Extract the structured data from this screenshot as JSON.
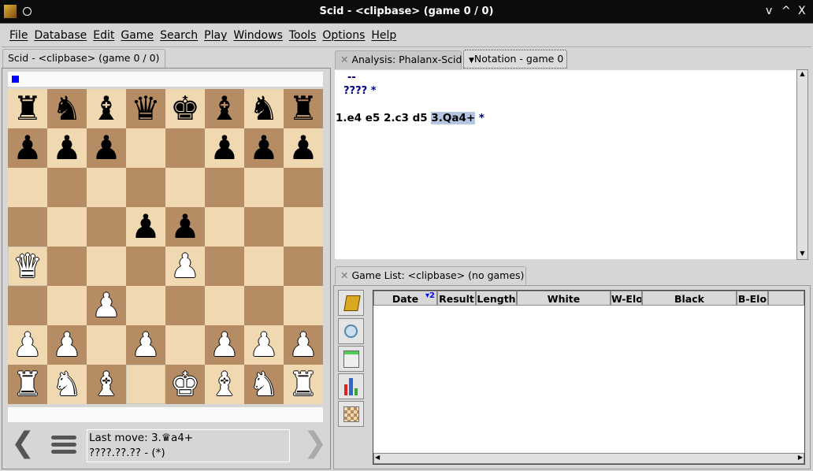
{
  "window": {
    "title": "Scid - <clipbase> (game 0 / 0)",
    "controls": [
      "v",
      "^",
      "X"
    ]
  },
  "menu": [
    "File",
    "Database",
    "Edit",
    "Game",
    "Search",
    "Play",
    "Windows",
    "Tools",
    "Options",
    "Help"
  ],
  "board_tab": "Scid - <clipbase> (game 0 / 0)",
  "board": [
    [
      "bR",
      "bN",
      "bB",
      "bQ",
      "bK",
      "bB",
      "bN",
      "bR"
    ],
    [
      "bP",
      "bP",
      "bP",
      "",
      "",
      "bP",
      "bP",
      "bP"
    ],
    [
      "",
      "",
      "",
      "",
      "",
      "",
      "",
      ""
    ],
    [
      "",
      "",
      "",
      "bP",
      "bP",
      "",
      "",
      ""
    ],
    [
      "wQ",
      "",
      "",
      "",
      "wP",
      "",
      "",
      ""
    ],
    [
      "",
      "",
      "wP",
      "",
      "",
      "",
      "",
      ""
    ],
    [
      "wP",
      "wP",
      "",
      "wP",
      "",
      "wP",
      "wP",
      "wP"
    ],
    [
      "wR",
      "wN",
      "wB",
      "",
      "wK",
      "wB",
      "wN",
      "wR"
    ]
  ],
  "highlight_squares": [
    "a4",
    "d1"
  ],
  "side_to_move_color": "#0000ff",
  "status": {
    "last_move": "Last move: 3.♛a4+",
    "game_info": "????.??.?? -  (*)"
  },
  "right_tabs": {
    "analysis": "Analysis: Phalanx-Scid",
    "notation": "Notation - game 0"
  },
  "notation": {
    "line1": "--",
    "line2": "????  *",
    "moves": "1.e4 e5 2.c3 d5 ",
    "current_move": "3.Qa4+",
    "result": " *"
  },
  "gamelist": {
    "tab": "Game List: <clipbase> (no games)",
    "sort_marker": "▾2",
    "columns": [
      "Date",
      "Result",
      "Length",
      "White",
      "W-Elo",
      "Black",
      "B-Elo"
    ]
  }
}
